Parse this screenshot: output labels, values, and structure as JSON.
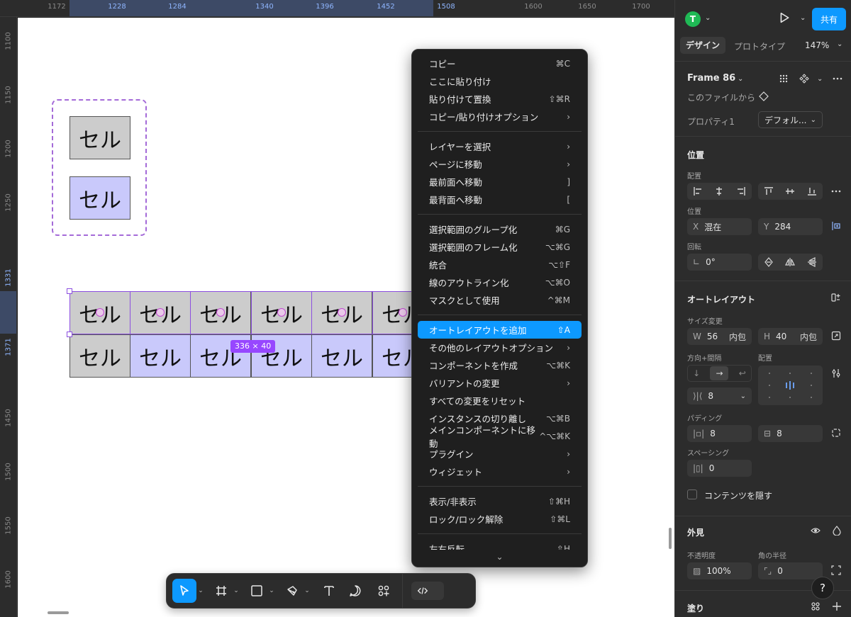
{
  "ruler": {
    "top_ticks": [
      "1172",
      "1228",
      "1284",
      "1340",
      "1396",
      "1452",
      "1508",
      "1600",
      "1650",
      "1700"
    ],
    "left_ticks": [
      "1100",
      "1150",
      "1200",
      "1250",
      "1331",
      "1371",
      "1450",
      "1500",
      "1550",
      "1600"
    ]
  },
  "canvas": {
    "variant_cells": [
      "セル",
      "セル"
    ],
    "grid_row1": [
      "セル",
      "セル",
      "セル",
      "セル",
      "セル",
      "セル"
    ],
    "grid_row2": [
      "セル",
      "セル",
      "セル",
      "セル",
      "セル",
      "セル"
    ],
    "selection_size": "336 × 40"
  },
  "context_menu": {
    "groups": [
      [
        {
          "label": "コピー",
          "shortcut": "⌘C"
        },
        {
          "label": "ここに貼り付け",
          "shortcut": ""
        },
        {
          "label": "貼り付けて置換",
          "shortcut": "⇧⌘R"
        },
        {
          "label": "コピー/貼り付けオプション",
          "shortcut": "›"
        }
      ],
      [
        {
          "label": "レイヤーを選択",
          "shortcut": "›"
        },
        {
          "label": "ページに移動",
          "shortcut": "›"
        },
        {
          "label": "最前面へ移動",
          "shortcut": "]"
        },
        {
          "label": "最背面へ移動",
          "shortcut": "["
        }
      ],
      [
        {
          "label": "選択範囲のグループ化",
          "shortcut": "⌘G"
        },
        {
          "label": "選択範囲のフレーム化",
          "shortcut": "⌥⌘G"
        },
        {
          "label": "統合",
          "shortcut": "⌥⇧F"
        },
        {
          "label": "線のアウトライン化",
          "shortcut": "⌥⌘O"
        },
        {
          "label": "マスクとして使用",
          "shortcut": "^⌘M"
        }
      ],
      [
        {
          "label": "オートレイアウトを追加",
          "shortcut": "⇧A",
          "active": true
        },
        {
          "label": "その他のレイアウトオプション",
          "shortcut": "›"
        },
        {
          "label": "コンポーネントを作成",
          "shortcut": "⌥⌘K"
        },
        {
          "label": "バリアントの変更",
          "shortcut": "›"
        },
        {
          "label": "すべての変更をリセット",
          "shortcut": ""
        },
        {
          "label": "インスタンスの切り離し",
          "shortcut": "⌥⌘B"
        },
        {
          "label": "メインコンポーネントに移動",
          "shortcut": "^⌥⌘K"
        },
        {
          "label": "プラグイン",
          "shortcut": "›"
        },
        {
          "label": "ウィジェット",
          "shortcut": "›"
        }
      ],
      [
        {
          "label": "表示/非表示",
          "shortcut": "⇧⌘H"
        },
        {
          "label": "ロック/ロック解除",
          "shortcut": "⇧⌘L"
        }
      ],
      [
        {
          "label": "左右反転",
          "shortcut": "⇧H"
        }
      ]
    ],
    "more_indicator": "⌄"
  },
  "toolbar": {
    "tools": [
      "move-tool",
      "frame-tool",
      "shape-tool",
      "pen-tool",
      "text-tool",
      "comment-tool",
      "actions-tool"
    ],
    "dev_mode_icon": "</>"
  },
  "panel": {
    "avatar_initial": "T",
    "share_label": "共有",
    "tabs": {
      "design": "デザイン",
      "prototype": "プロトタイプ"
    },
    "zoom": "147%",
    "frame_name": "Frame 86",
    "component_source": "このファイルから",
    "property_label": "プロパティ1",
    "property_value": "デフォル...",
    "position": {
      "title": "位置",
      "align_label": "配置",
      "position_label": "位置",
      "x_label": "X",
      "x_value": "混在",
      "y_label": "Y",
      "y_value": "284",
      "rotation_label": "回転",
      "rotation_value": "0°"
    },
    "auto_layout": {
      "title": "オートレイアウト",
      "resize_label": "サイズ変更",
      "w_label": "W",
      "w_value": "56",
      "w_mode": "内包",
      "h_label": "H",
      "h_value": "40",
      "h_mode": "内包",
      "direction_label": "方向+間隔",
      "alignment_label": "配置",
      "gap_value": "8",
      "padding_label": "パディング",
      "padding_h": "8",
      "padding_v": "8",
      "spacing_label": "スペーシング",
      "spacing_value": "0",
      "clip_label": "コンテンツを隠す"
    },
    "appearance": {
      "title": "外見",
      "opacity_label": "不透明度",
      "opacity_value": "100%",
      "radius_label": "角の半径",
      "radius_value": "0"
    },
    "fill_title": "塗り",
    "help_label": "?"
  },
  "colors": {
    "accent": "#0d99ff",
    "selection": "#8c4fe0",
    "cell_gray": "#cccccc",
    "cell_blue": "#c9c9fb",
    "panel_bg": "#2c2c2c"
  }
}
